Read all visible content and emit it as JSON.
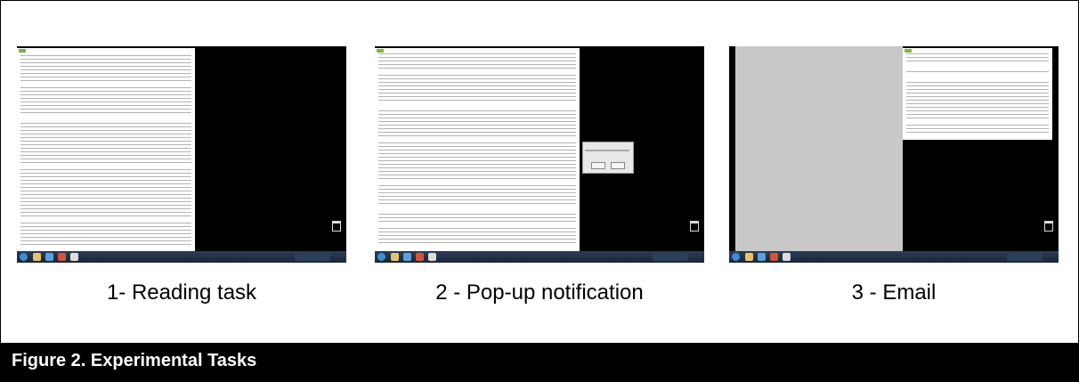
{
  "figure": {
    "caption": "Figure 2. Experimental Tasks",
    "panels": [
      {
        "label": "1- Reading task"
      },
      {
        "label": "2 - Pop-up notification"
      },
      {
        "label": "3 - Email"
      }
    ]
  },
  "colors": {
    "desktop": "#000000",
    "taskbar": "#1f2f44",
    "document": "#ffffff",
    "footer": "#000000",
    "email_pane": "#c8c8c8"
  },
  "icons": [
    "start-orb-icon",
    "file-explorer-icon",
    "ie-browser-icon",
    "media-player-icon",
    "app-icon",
    "recycle-bin-icon"
  ]
}
